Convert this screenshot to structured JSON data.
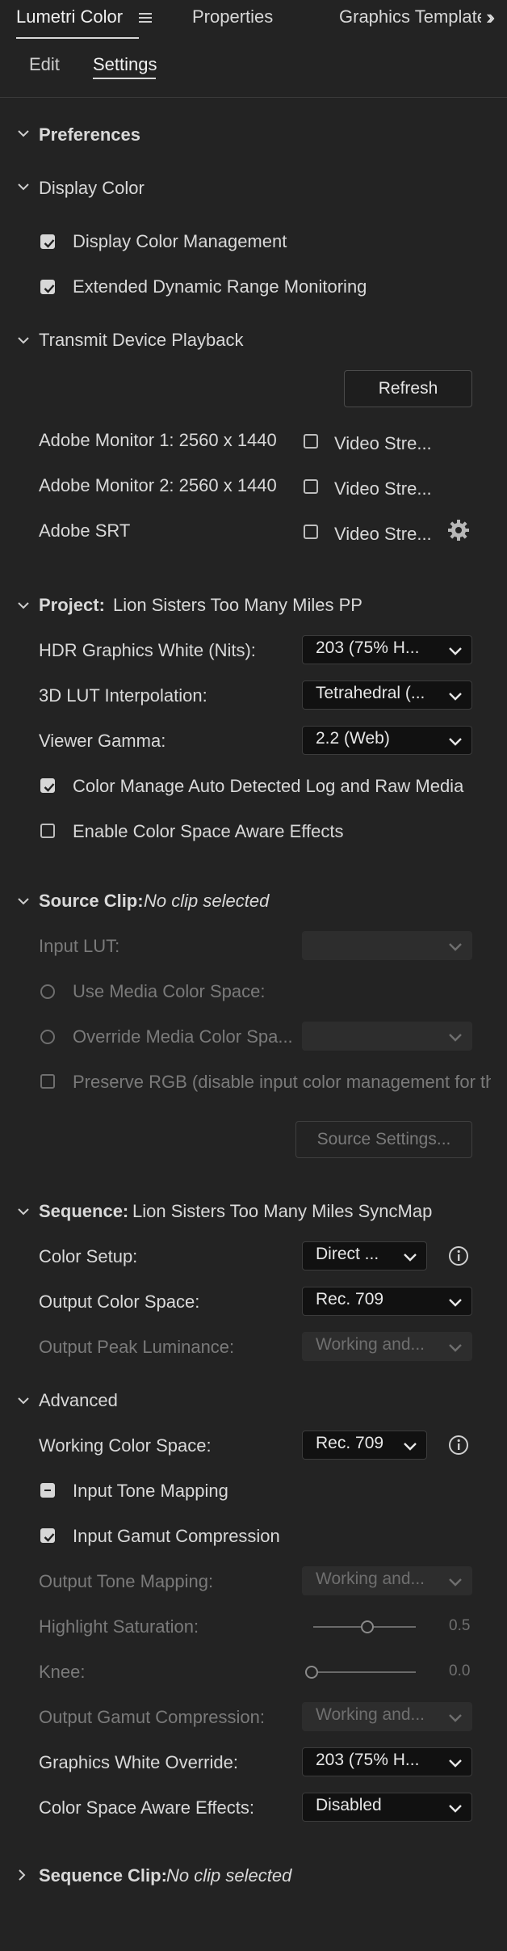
{
  "tabs": {
    "lumetri": "Lumetri Color",
    "properties": "Properties",
    "graphics": "Graphics Templates"
  },
  "subtabs": {
    "edit": "Edit",
    "settings": "Settings"
  },
  "sections": {
    "preferences": "Preferences",
    "display_color": "Display Color",
    "transmit": "Transmit Device Playback",
    "project_label": "Project:",
    "project_name": "Lion Sisters Too Many Miles PP",
    "source_label": "Source Clip:",
    "source_value": "No clip selected",
    "sequence_label": "Sequence:",
    "sequence_name": "Lion Sisters Too Many Miles SyncMap",
    "advanced": "Advanced",
    "seqclip_label": "Sequence Clip:",
    "seqclip_value": "No clip selected"
  },
  "display_color": {
    "management": "Display Color Management",
    "edr": "Extended Dynamic Range Monitoring"
  },
  "transmit": {
    "refresh": "Refresh",
    "monitor1": "Adobe Monitor 1: 2560 x 1440",
    "monitor2": "Adobe Monitor 2: 2560 x 1440",
    "srt": "Adobe SRT",
    "video_stream": "Video Stre..."
  },
  "project": {
    "hdr_label": "HDR Graphics White (Nits):",
    "hdr_value": "203 (75% H...",
    "lut_label": "3D LUT Interpolation:",
    "lut_value": "Tetrahedral (...",
    "gamma_label": "Viewer Gamma:",
    "gamma_value": "2.2 (Web)",
    "auto_log": "Color Manage Auto Detected Log and Raw Media",
    "aware": "Enable Color Space Aware Effects"
  },
  "source": {
    "input_lut": "Input LUT:",
    "use_media": "Use Media Color Space:",
    "override_media": "Override Media Color Spa...",
    "preserve_rgb": "Preserve RGB (disable input color management for th",
    "settings_btn": "Source Settings..."
  },
  "sequence": {
    "setup_label": "Color Setup:",
    "setup_value": "Direct ...",
    "output_cs_label": "Output Color Space:",
    "output_cs_value": "Rec. 709",
    "peak_label": "Output Peak Luminance:",
    "peak_value": "Working and..."
  },
  "advanced": {
    "working_label": "Working Color Space:",
    "working_value": "Rec. 709",
    "tone_mapping": "Input Tone Mapping",
    "gamut_comp": "Input Gamut Compression",
    "out_tone_label": "Output Tone Mapping:",
    "out_tone_value": "Working and...",
    "highlight_label": "Highlight Saturation:",
    "highlight_value": "0.5",
    "knee_label": "Knee:",
    "knee_value": "0.0",
    "out_gamut_label": "Output Gamut Compression:",
    "out_gamut_value": "Working and...",
    "gfx_white_label": "Graphics White Override:",
    "gfx_white_value": "203 (75% H...",
    "aware_label": "Color Space Aware Effects:",
    "aware_value": "Disabled"
  }
}
